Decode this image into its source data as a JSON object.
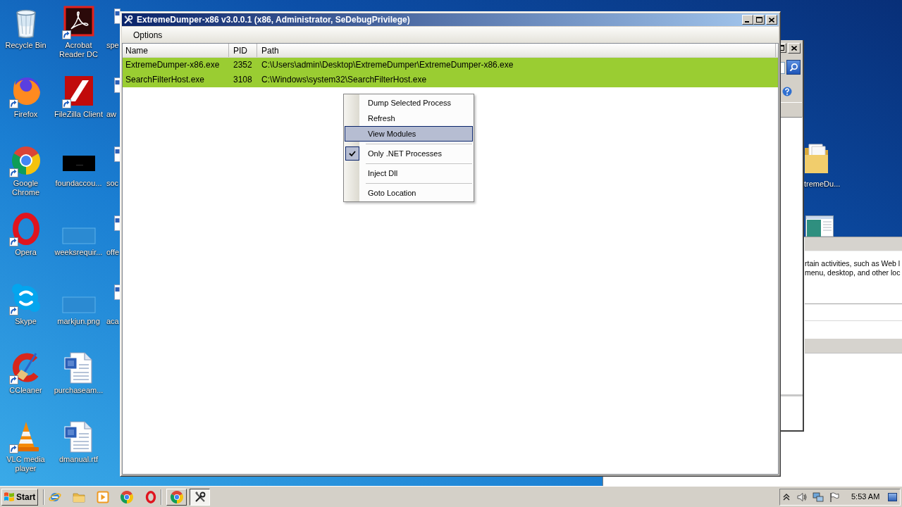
{
  "desktop": {
    "columns": [
      {
        "icons": [
          {
            "kind": "bin",
            "label": "Recycle Bin",
            "shortcut": false
          },
          {
            "kind": "fox",
            "label": "Firefox",
            "shortcut": true
          },
          {
            "kind": "wheel",
            "label": "Google Chrome",
            "shortcut": true
          },
          {
            "kind": "ring",
            "label": "Opera",
            "shortcut": true
          },
          {
            "kind": "cloud",
            "label": "Skype",
            "shortcut": true
          },
          {
            "kind": "broom",
            "label": "CCleaner",
            "shortcut": true
          },
          {
            "kind": "cone",
            "label": "VLC media player",
            "shortcut": true
          }
        ]
      },
      {
        "icons": [
          {
            "kind": "pdf",
            "label": "Acrobat Reader DC",
            "shortcut": true
          },
          {
            "kind": "ftp",
            "label": "FileZilla Client",
            "shortcut": true
          },
          {
            "kind": "blackimage",
            "label": "foundaccou...",
            "shortcut": false
          },
          {
            "kind": "blankimage",
            "label": "weeksrequir...",
            "shortcut": false
          },
          {
            "kind": "blankimage",
            "label": "markjun.png",
            "shortcut": false
          },
          {
            "kind": "worddoc",
            "label": "purchaseam...",
            "shortcut": false
          },
          {
            "kind": "worddoc",
            "label": "dmanual.rtf",
            "shortcut": false
          }
        ]
      },
      {
        "icons": [
          {
            "kind": "docedge",
            "label": "spe"
          },
          {
            "kind": "docedge",
            "label": "aw"
          },
          {
            "kind": "docedge",
            "label": "soc"
          },
          {
            "kind": "docedge",
            "label": "offe"
          },
          {
            "kind": "docedge",
            "label": "aca"
          }
        ]
      }
    ],
    "right_icons": [
      {
        "kind": "folder",
        "label": "tremeDu..."
      },
      {
        "kind": "thumbnail"
      }
    ]
  },
  "main_window": {
    "title": "ExtremeDumper-x86 v3.0.0.1 (x86, Administrator, SeDebugPrivilege)",
    "menu": [
      {
        "label": "Options"
      }
    ],
    "columns": [
      "Name",
      "PID",
      "Path"
    ],
    "rows": [
      {
        "cells": [
          "ExtremeDumper-x86.exe",
          "2352",
          "C:\\Users\\admin\\Desktop\\ExtremeDumper\\ExtremeDumper-x86.exe"
        ],
        "color": "#9acd32"
      },
      {
        "cells": [
          "SearchFilterHost.exe",
          "3108",
          "C:\\Windows\\system32\\SearchFilterHost.exe"
        ],
        "color": "#9acd32"
      }
    ]
  },
  "context_menu": {
    "items": [
      {
        "kind": "item",
        "label": "Dump Selected Process",
        "checked": false,
        "highlighted": false
      },
      {
        "kind": "item",
        "label": "Refresh",
        "checked": false,
        "highlighted": false
      },
      {
        "kind": "item",
        "label": "View Modules",
        "checked": false,
        "highlighted": true
      },
      {
        "kind": "separator"
      },
      {
        "kind": "item",
        "label": "Only .NET Processes",
        "checked": true,
        "highlighted": false
      },
      {
        "kind": "separator"
      },
      {
        "kind": "item",
        "label": "Inject Dll",
        "checked": false,
        "highlighted": false
      },
      {
        "kind": "separator"
      },
      {
        "kind": "item",
        "label": "Goto Location",
        "checked": false,
        "highlighted": false
      }
    ]
  },
  "side_window": {
    "lines": [
      "rtain activities, such as Web l",
      "menu, desktop, and other loc"
    ]
  },
  "taskbar": {
    "start": "Start",
    "tasks": [
      {
        "kind": "browser",
        "active": false
      },
      {
        "kind": "tools",
        "active": true
      }
    ],
    "clock": "5:53 AM"
  }
}
